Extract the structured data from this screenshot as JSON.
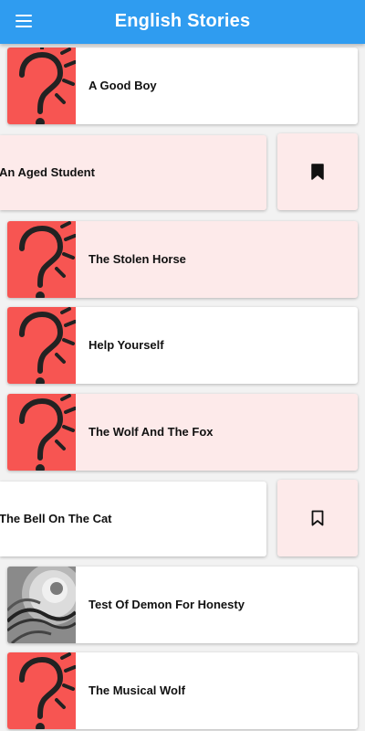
{
  "app_bar": {
    "title": "English Stories",
    "menu_icon": "hamburger-menu-icon",
    "color": "#2f9cf0"
  },
  "stories": [
    {
      "title": "A Good Boy",
      "image": "question-mark",
      "highlighted": false
    },
    {
      "title": "An Aged Student",
      "image": "question-mark",
      "highlighted": true,
      "swiped": true,
      "bookmark_icon": "bookmark-filled-icon"
    },
    {
      "title": "The Stolen Horse",
      "image": "question-mark",
      "highlighted": true
    },
    {
      "title": "Help Yourself",
      "image": "question-mark",
      "highlighted": false
    },
    {
      "title": "The Wolf And The Fox",
      "image": "question-mark",
      "highlighted": true
    },
    {
      "title": "The Bell On The Cat",
      "image": "question-mark",
      "highlighted": false,
      "swiped": true,
      "bookmark_icon": "bookmark-outline-icon"
    },
    {
      "title": "Test Of Demon For Honesty",
      "image": "spiral-staircase-photo",
      "highlighted": false
    },
    {
      "title": "The Musical Wolf",
      "image": "question-mark",
      "highlighted": false
    }
  ],
  "colors": {
    "thumbnail_red": "#f75552",
    "highlight_pink": "#fdeaea"
  }
}
